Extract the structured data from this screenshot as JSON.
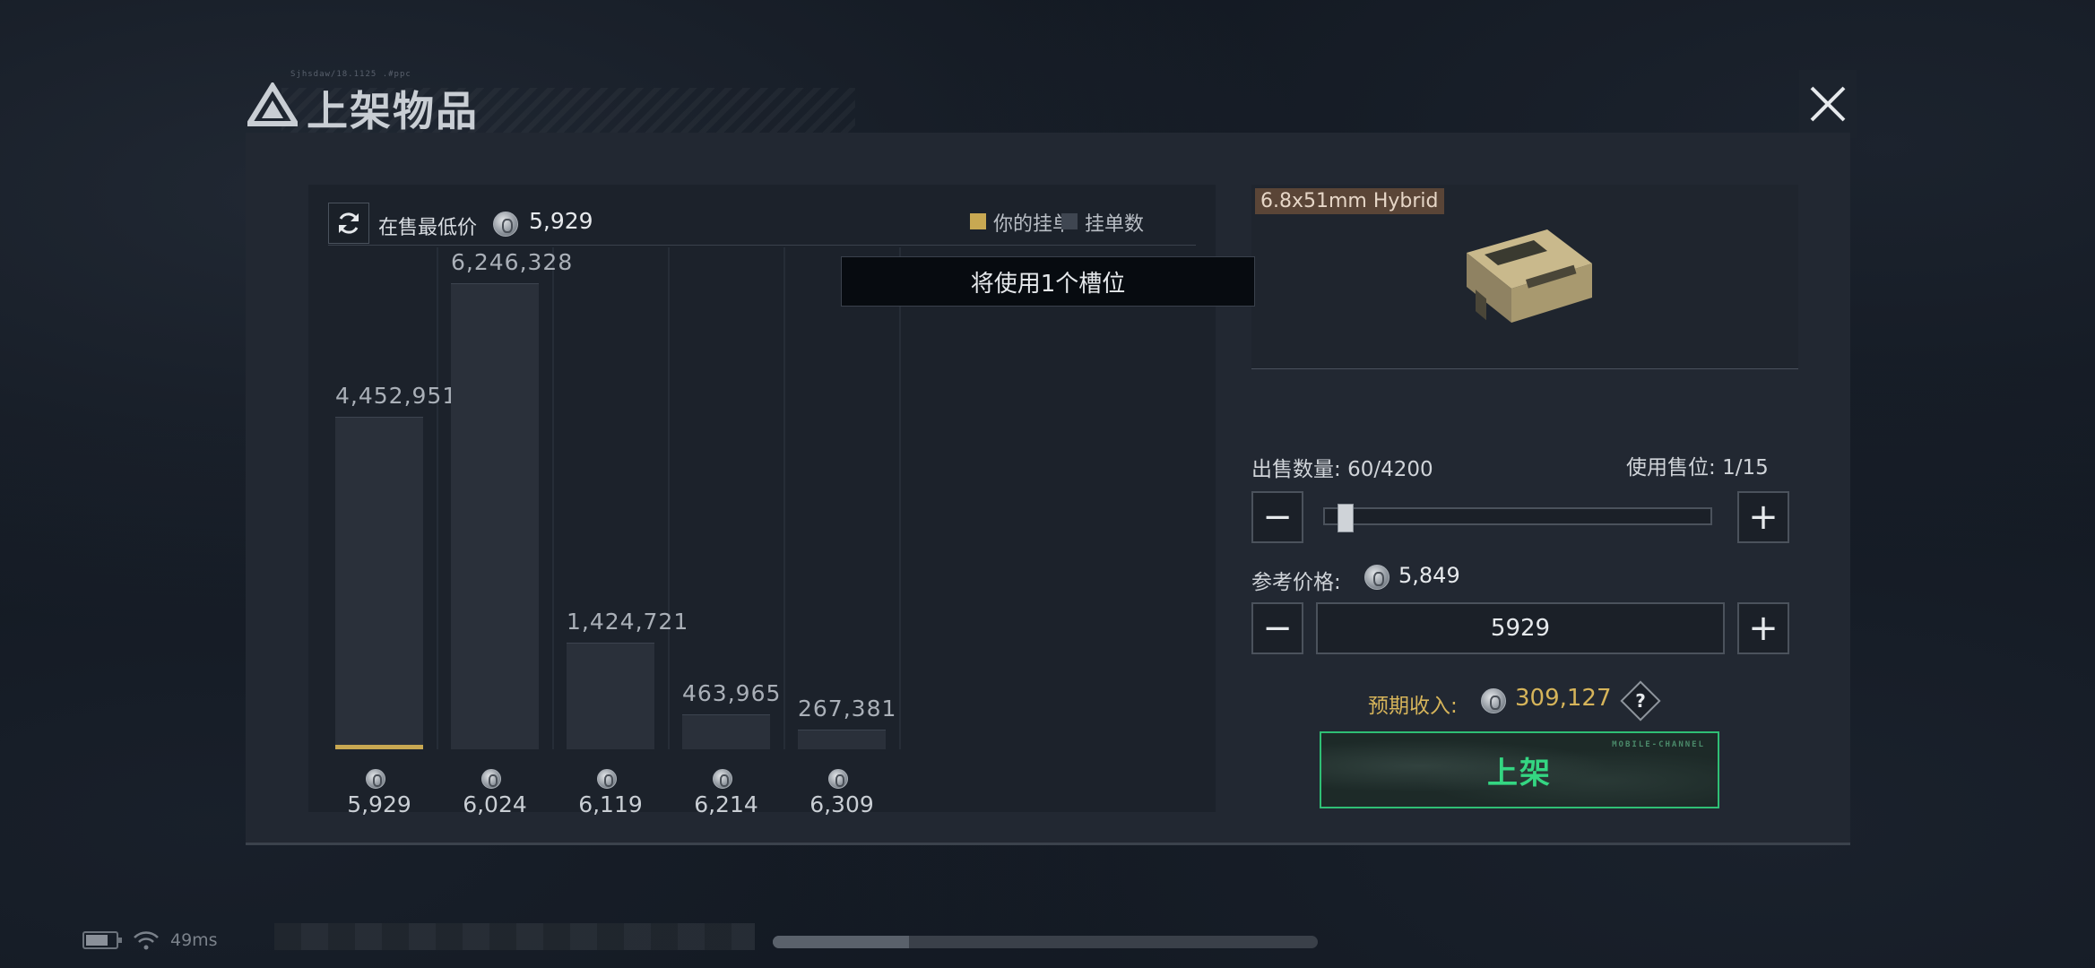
{
  "header": {
    "title": "上架物品",
    "tiny_text": "Sjhsdaw/18.1125 .#ppc"
  },
  "chart_panel": {
    "lowest_price_label": "在售最低价",
    "lowest_price_value": "5,929",
    "legend": {
      "mine": "你的挂单",
      "orders": "挂单数"
    },
    "tooltip": "将使用1个槽位"
  },
  "chart_data": {
    "type": "bar",
    "categories": [
      "5,929",
      "6,024",
      "6,119",
      "6,214",
      "6,309"
    ],
    "values": [
      4452951,
      6246328,
      1424721,
      463965,
      267381
    ],
    "labels": [
      "4,452,951",
      "6,246,328",
      "1,424,721",
      "463,965",
      "267,381"
    ],
    "highlight_index": 0,
    "series": [
      {
        "name": "挂单数",
        "values": [
          4452951,
          6246328,
          1424721,
          463965,
          267381
        ]
      }
    ],
    "colors": {
      "bar": "#2a303a",
      "mine": "#c8a852"
    },
    "xlabel": "",
    "ylabel": ""
  },
  "item": {
    "name": "6.8x51mm Hybrid"
  },
  "sell": {
    "quantity_label": "出售数量:",
    "quantity_value": "60/4200",
    "quantity_fraction": 0.0143,
    "slot_label": "使用售位:",
    "slot_value": "1/15",
    "minus": "−",
    "plus": "+",
    "ref_price_label": "参考价格:",
    "ref_price_value": "5,849",
    "price_input": "5929",
    "income_label": "预期收入:",
    "income_value": "309,127",
    "help": "?",
    "list_button": "上架",
    "list_button_deco": "MOBILE-CHANNEL"
  },
  "status": {
    "ping": "49ms",
    "progress": 0.25
  },
  "colors": {
    "accent_gold": "#c8a852",
    "accent_green": "#34d682",
    "panel": "#222832"
  }
}
